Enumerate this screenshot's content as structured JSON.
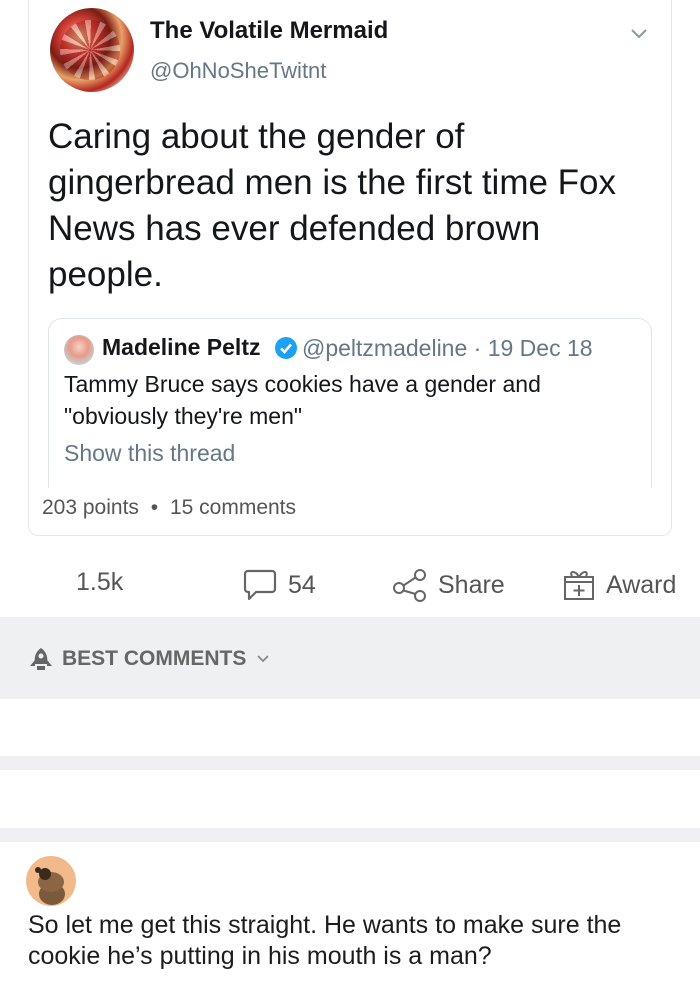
{
  "tweet": {
    "author_name": "The Volatile Mermaid",
    "author_handle": "@OhNoSheTwitnt",
    "text": "Caring about the gender of gingerbread men is the first time Fox News has ever defended brown people.",
    "quoted": {
      "author_name": "Madeline Peltz",
      "handle_date": "@peltzmadeline · 19 Dec 18",
      "text": "Tammy Bruce says cookies have a gender and \"obviously they're men\"",
      "show_thread": "Show this thread"
    }
  },
  "post_stats": {
    "points": "203 points",
    "separator": "•",
    "comments": "15 comments"
  },
  "actions": {
    "votes": "1.5k",
    "comments": "54",
    "share": "Share",
    "award": "Award"
  },
  "comments_header": {
    "sort_label": "BEST COMMENTS"
  },
  "comment": {
    "text": "So let me get this straight. He wants to make sure the cookie he’s putting in his mouth is a man?"
  },
  "colors": {
    "band": "#eef0f1",
    "verified": "#1da1f2",
    "muted": "#657786"
  }
}
